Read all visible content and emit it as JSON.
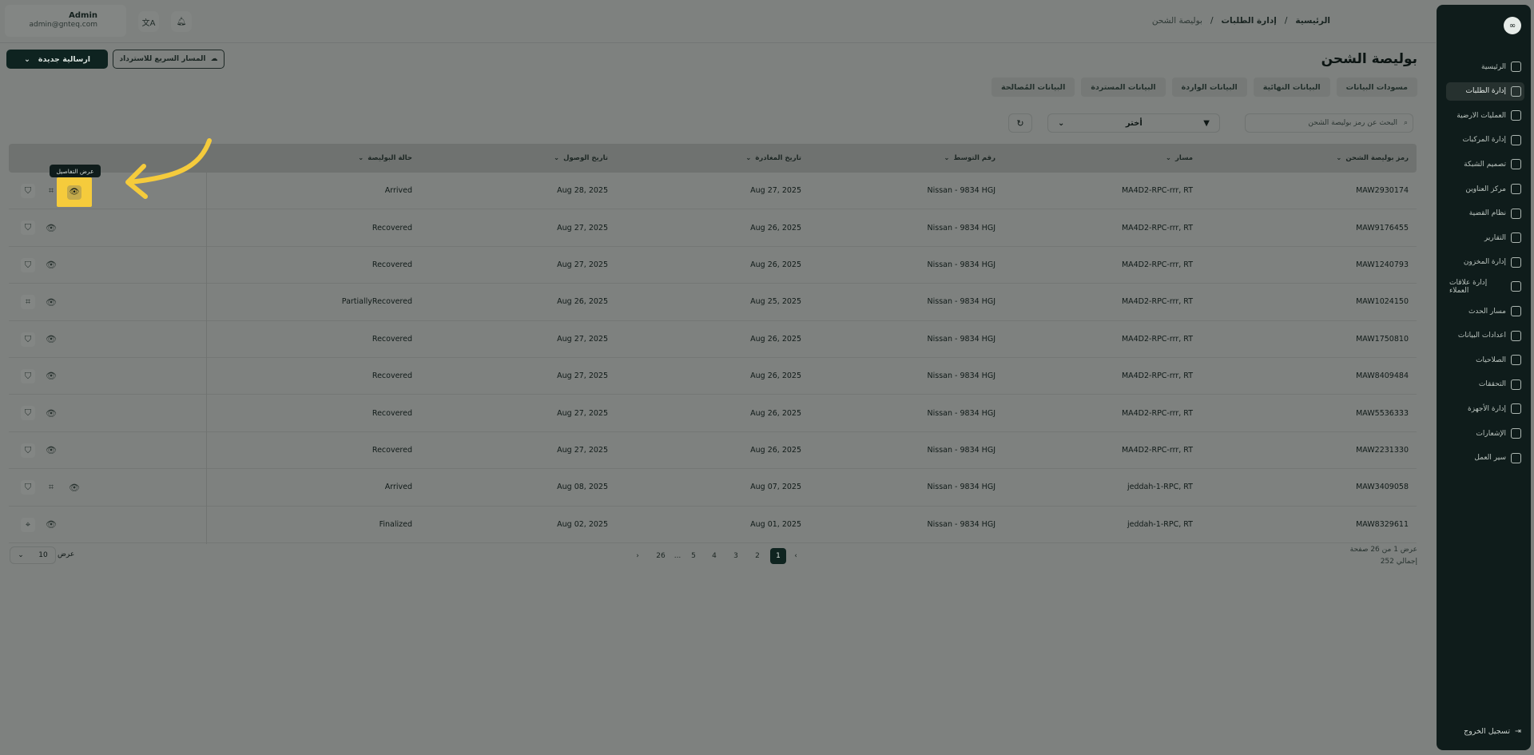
{
  "user": {
    "name": "Admin",
    "email": "admin@gnteq.com"
  },
  "breadcrumb": [
    "الرئيسية",
    "إدارة الطلبات",
    "بوليصة الشحن"
  ],
  "page": {
    "title": "بوليصة الشحن"
  },
  "buttons": {
    "new_shipment": "ارسالية جديدة",
    "quick_route": "المسار السريع للاسترداد"
  },
  "tabs": [
    "مسودات البيانات",
    "البيانات النهائية",
    "البيانات الواردة",
    "البيانات المستردة",
    "البيانات المُصالحة"
  ],
  "filters": {
    "search_placeholder": "البحث عن رمز بوليصة الشحن",
    "select_value": "أختر"
  },
  "table": {
    "headers": [
      "رمز بوليصة الشحن",
      "مسار",
      "رقم التوسط",
      "تاريخ المغادرة",
      "تاريخ الوصول",
      "حالة البوليصة"
    ],
    "rows": [
      [
        "MAW2930174",
        "MA4D2-RPC-rrr, RT",
        "Nissan - 9834 HGJ",
        "Aug 27, 2025",
        "Aug 28, 2025",
        "Arrived"
      ],
      [
        "MAW9176455",
        "MA4D2-RPC-rrr, RT",
        "Nissan - 9834 HGJ",
        "Aug 26, 2025",
        "Aug 27, 2025",
        "Recovered"
      ],
      [
        "MAW1240793",
        "MA4D2-RPC-rrr, RT",
        "Nissan - 9834 HGJ",
        "Aug 26, 2025",
        "Aug 27, 2025",
        "Recovered"
      ],
      [
        "MAW1024150",
        "MA4D2-RPC-rrr, RT",
        "Nissan - 9834 HGJ",
        "Aug 25, 2025",
        "Aug 26, 2025",
        "PartiallyRecovered"
      ],
      [
        "MAW1750810",
        "MA4D2-RPC-rrr, RT",
        "Nissan - 9834 HGJ",
        "Aug 26, 2025",
        "Aug 27, 2025",
        "Recovered"
      ],
      [
        "MAW8409484",
        "MA4D2-RPC-rrr, RT",
        "Nissan - 9834 HGJ",
        "Aug 26, 2025",
        "Aug 27, 2025",
        "Recovered"
      ],
      [
        "MAW5536333",
        "MA4D2-RPC-rrr, RT",
        "Nissan - 9834 HGJ",
        "Aug 26, 2025",
        "Aug 27, 2025",
        "Recovered"
      ],
      [
        "MAW2231330",
        "MA4D2-RPC-rrr, RT",
        "Nissan - 9834 HGJ",
        "Aug 26, 2025",
        "Aug 27, 2025",
        "Recovered"
      ],
      [
        "MAW3409058",
        "jeddah-1-RPC, RT",
        "Nissan - 9834 HGJ",
        "Aug 07, 2025",
        "Aug 08, 2025",
        "Arrived"
      ],
      [
        "MAW8329611",
        "jeddah-1-RPC, RT",
        "Nissan - 9834 HGJ",
        "Aug 01, 2025",
        "Aug 02, 2025",
        "Finalized"
      ]
    ]
  },
  "tooltip": "عرض التفاصيل",
  "pagination": {
    "pages": [
      "1",
      "2",
      "3",
      "4",
      "5",
      "...",
      "26"
    ],
    "info_line1": "عرض 1 من 26 صفحة",
    "info_line2": "إجمالي 252",
    "per_page": "10",
    "per_page_label": "عرض"
  },
  "sidebar": {
    "items": [
      "الرئيسية",
      "إدارة الطلبات",
      "العمليات الارضية",
      "إدارة المركبات",
      "تصميم الشبكة",
      "مركز العناوين",
      "نظام القضية",
      "التقارير",
      "إدارة المخزون",
      "إدارة علاقات العملاء",
      "مسار الحدث",
      "اعدادات البيانات",
      "الصلاحيات",
      "التحققات",
      "إدارة الأجهزة",
      "الإشعارات",
      "سير العمل"
    ],
    "logout": "تسجيل الخروج"
  },
  "colors": {
    "sidebar_bg": "#0f1c1b",
    "highlight": "#f5cb3c",
    "primary": "#0e2320"
  }
}
